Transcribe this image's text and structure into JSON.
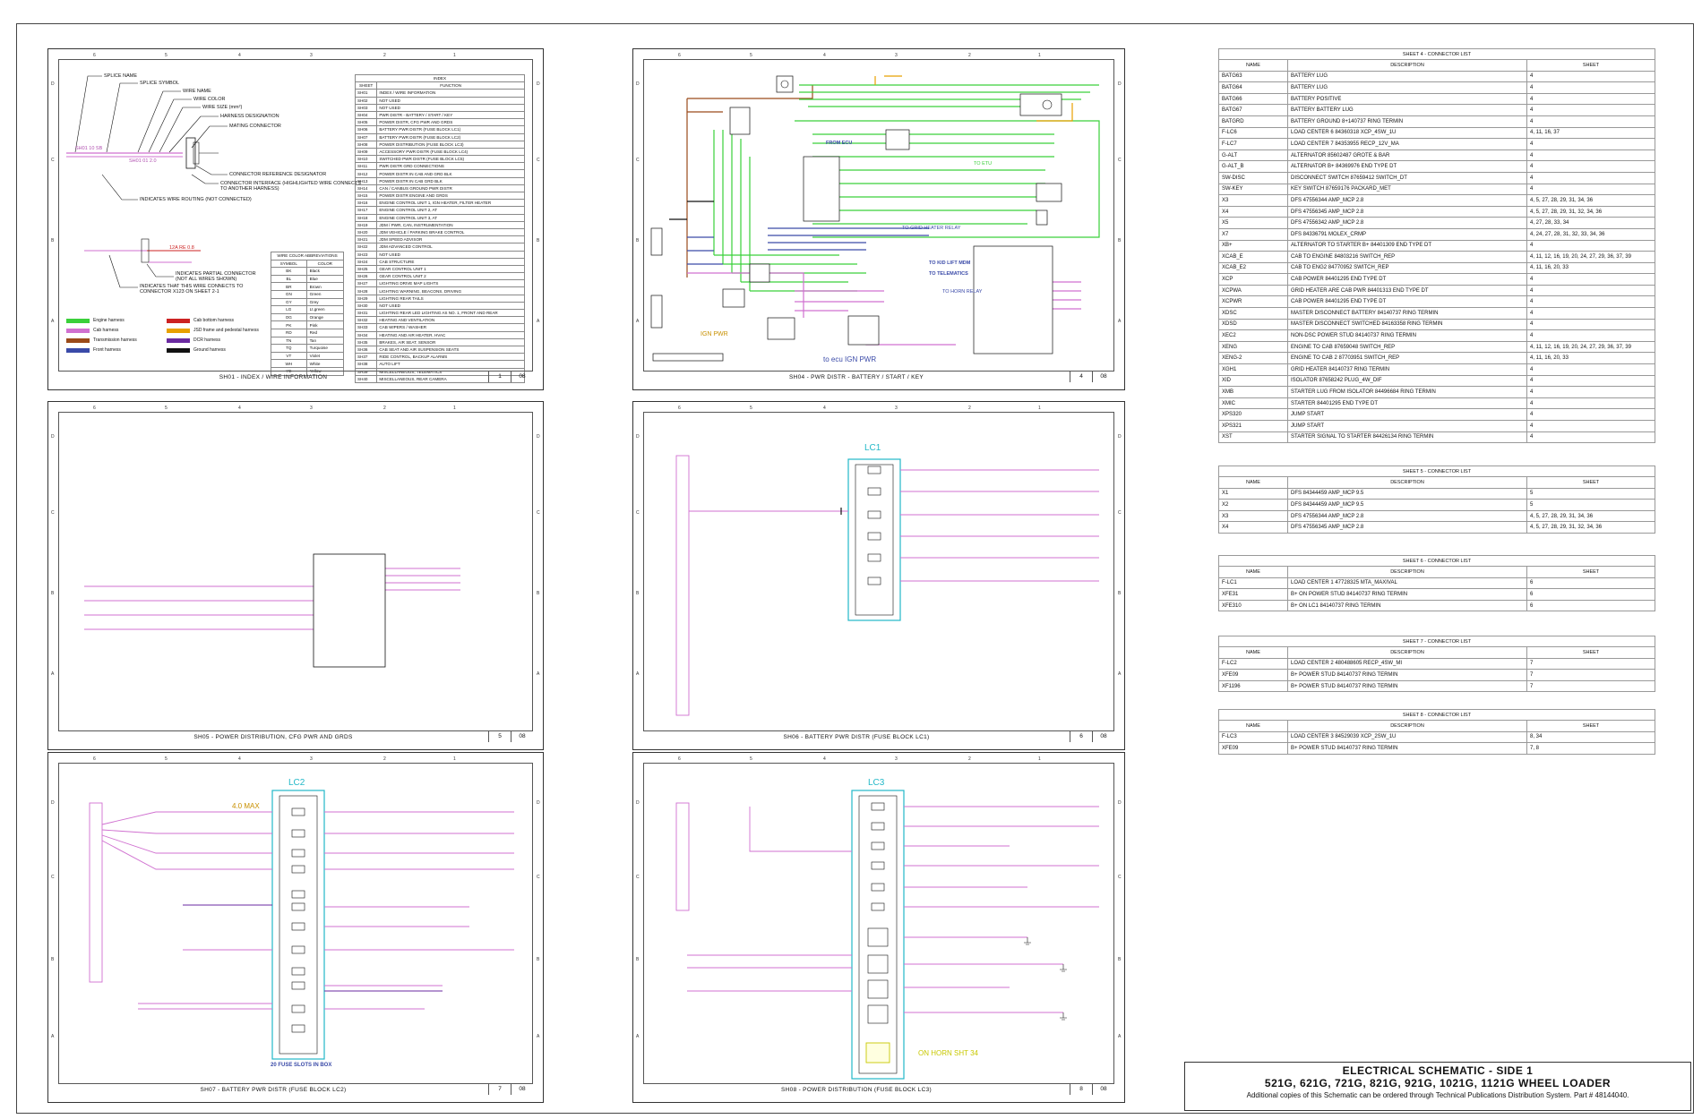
{
  "colors": {
    "engine": "#3ad03a",
    "cab": "#d070d0",
    "transmission": "#9a4a1a",
    "front": "#3a4aa8",
    "cab_bottom": "#cc2222",
    "jsd": "#e8a000",
    "dcr": "#6a2aa0",
    "ground": "#111111",
    "fuse_box": "#22b8c8"
  },
  "sheets": [
    {
      "title": "SH01 - INDEX / WIRE INFORMATION",
      "num": "1",
      "of": "08"
    },
    {
      "title": "SH04 - PWR DISTR - BATTERY / START / KEY",
      "num": "4",
      "of": "08"
    },
    {
      "title": "SH05 - POWER DISTRIBUTION, CFG PWR AND GRDS",
      "num": "5",
      "of": "08"
    },
    {
      "title": "SH06 - BATTERY PWR DISTR (FUSE BLOCK LC1)",
      "num": "6",
      "of": "08"
    },
    {
      "title": "SH07 - BATTERY PWR DISTR (FUSE BLOCK LC2)",
      "num": "7",
      "of": "08"
    },
    {
      "title": "SH08 - POWER DISTRIBUTION (FUSE BLOCK LC3)",
      "num": "8",
      "of": "08"
    }
  ],
  "sheet1": {
    "index_title": "INDEX",
    "index_head": [
      "SHEET",
      "FUNCTION"
    ],
    "index_rows": [
      [
        "SH01",
        "INDEX / WIRE INFORMATION"
      ],
      [
        "SH02",
        "NOT USED"
      ],
      [
        "SH03",
        "NOT USED"
      ],
      [
        "SH04",
        "PWR DISTR - BATTERY / START / KEY"
      ],
      [
        "SH05",
        "POWER DISTR, CFG PWR AND GRDS"
      ],
      [
        "SH06",
        "BATTERY PWR DISTR (FUSE BLOCK LC1)"
      ],
      [
        "SH07",
        "BATTERY PWR DISTR (FUSE BLOCK LC2)"
      ],
      [
        "SH08",
        "POWER DISTRIBUTION (FUSE BLOCK LC3)"
      ],
      [
        "SH09",
        "ACCESSORY PWR DISTR (FUSE BLOCK LC4)"
      ],
      [
        "SH10",
        "SWITCHED PWR DISTR (FUSE BLOCK LC5)"
      ],
      [
        "SH11",
        "PWR DISTR GRD CONNECTIONS"
      ],
      [
        "SH12",
        "POWER DISTR IN CAB AND GRD BLK"
      ],
      [
        "SH13",
        "POWER DISTR IN CAB GRD BLK"
      ],
      [
        "SH14",
        "CAN / CANBUS GROUND PWR DISTR"
      ],
      [
        "SH15",
        "POWER DISTR ENGINE AND GRDS"
      ],
      [
        "SH16",
        "ENGINE CONTROL UNIT 1, IGN HEATER, FILTER HEATER"
      ],
      [
        "SH17",
        "ENGINE CONTROL UNIT 2, AT"
      ],
      [
        "SH18",
        "ENGINE CONTROL UNIT 3, AT"
      ],
      [
        "SH19",
        "JDM / PWR, CAN, INSTRUMENTATION"
      ],
      [
        "SH20",
        "JDM VEHICLE / PARKING BRAKE CONTROL"
      ],
      [
        "SH21",
        "JDM SPEED ADVISOR"
      ],
      [
        "SH22",
        "JDM ADVANCED CONTROL"
      ],
      [
        "SH23",
        "NOT USED"
      ],
      [
        "SH24",
        "CAB STRUCTURE"
      ],
      [
        "SH25",
        "GEAR CONTROL UNIT 1"
      ],
      [
        "SH26",
        "GEAR CONTROL UNIT 2"
      ],
      [
        "SH27",
        "LIGHTING DRIVE MAP LIGHTS"
      ],
      [
        "SH28",
        "LIGHTING WARNING, BEACONS, DRIVING"
      ],
      [
        "SH29",
        "LIGHTING REAR TAILS"
      ],
      [
        "SH30",
        "NOT USED"
      ],
      [
        "SH31",
        "LIGHTING REAR LED LIGHTING AS NO. 1, FRONT AND REAR"
      ],
      [
        "SH32",
        "HEATING AND VENTILATION"
      ],
      [
        "SH33",
        "CAB WIPERS / WASHER"
      ],
      [
        "SH34",
        "HEATING AND AIR HEATER, HVAC"
      ],
      [
        "SH35",
        "BRAKES, AIR SEAT, SENSOR"
      ],
      [
        "SH36",
        "CAB SEAT AND AIR SUSPENSION SEATS"
      ],
      [
        "SH37",
        "RIDE CONTROL, BACKUP ALARMS"
      ],
      [
        "SH38",
        "AUTO LIFT"
      ],
      [
        "SH39",
        "MISCELLANEOUS, TELEMATICS"
      ],
      [
        "SH40",
        "MISCELLANEOUS, REAR CAMERA"
      ]
    ],
    "callouts": [
      "SPLICE NAME",
      "SPLICE SYMBOL",
      "WIRE NAME",
      "WIRE COLOR",
      "WIRE SIZE (mm²)",
      "HARNESS DESIGNATION",
      "MATING CONNECTOR",
      "CONNECTOR REFERENCE DESIGNATOR",
      "CONNECTOR INTERFACE (HIGHLIGHTED WIRE CONNECTS TO ANOTHER HARNESS)",
      "INDICATES WIRE ROUTING (NOT CONNECTED)",
      "INDICATES PARTIAL CONNECTOR (NOT ALL WIRES SHOWN)",
      "INDICATES THAT THIS WIRE CONNECTS TO CONNECTOR X123 ON SHEET 2-1"
    ],
    "sample_wire_a": "SH01 10  SB",
    "sample_wire_b": "SH01 01 2.0",
    "sample_wire_c": "12A  RE 0.8",
    "wire_table_title": "WIRE COLOR ABBREVIATIONS",
    "wire_head": [
      "SYMBOL",
      "COLOR"
    ],
    "wire_rows": [
      [
        "BK",
        "Black"
      ],
      [
        "BL",
        "Blue"
      ],
      [
        "BR",
        "Brown"
      ],
      [
        "GN",
        "Green"
      ],
      [
        "GY",
        "Grey"
      ],
      [
        "LG",
        "Lt.green"
      ],
      [
        "OG",
        "Orange"
      ],
      [
        "PK",
        "Pink"
      ],
      [
        "RD",
        "Red"
      ],
      [
        "TN",
        "Tan"
      ],
      [
        "TQ",
        "Turquoise"
      ],
      [
        "VT",
        "Violet"
      ],
      [
        "WH",
        "White"
      ],
      [
        "YE",
        "Yellow"
      ]
    ],
    "legend": [
      {
        "label": "Engine harness",
        "color": "#3ad03a"
      },
      {
        "label": "Cab bottom harness",
        "color": "#cc2222"
      },
      {
        "label": "Cab harness",
        "color": "#d070d0"
      },
      {
        "label": "JSD frame and pedestal harness",
        "color": "#e8a000"
      },
      {
        "label": "Transmission harness",
        "color": "#9a4a1a"
      },
      {
        "label": "DCR harness",
        "color": "#6a2aa0"
      },
      {
        "label": "Front harness",
        "color": "#3a4aa8"
      },
      {
        "label": "Ground harness",
        "color": "#111111"
      }
    ]
  },
  "sheet4": {
    "labels": {
      "from_ecu": "FROM ECU",
      "to_grid": "TO GRID HEATER RELAY",
      "to_lift": "TO KID LIFT MDM",
      "to_tele": "TO TELEMATICS",
      "to_ecu_ign": "to ecu IGN PWR",
      "ign_pwr": "IGN PWR",
      "to_etu": "TO ETU",
      "to_horn": "TO HORN RELAY"
    }
  },
  "sheet6": {
    "fuse_label": "LC1"
  },
  "sheet7": {
    "fuse_label": "LC2",
    "note": "4.0 MAX",
    "bottom_note": "20 FUSE SLOTS IN BOX"
  },
  "sheet8": {
    "fuse_label": "LC3",
    "horn_note": "ON HORN SHT 34"
  },
  "conn_head": [
    "NAME",
    "DESCRIPTION",
    "SHEET"
  ],
  "conn_lists": [
    {
      "title": "SHEET 4 - CONNECTOR LIST",
      "rows": [
        [
          "BATG63",
          "BATTERY LUG",
          "4"
        ],
        [
          "BATG64",
          "BATTERY LUG",
          "4"
        ],
        [
          "BATG66",
          "BATTERY POSITIVE",
          "4"
        ],
        [
          "BATG67",
          "BATTERY BATTERY LUG",
          "4"
        ],
        [
          "BATGRD",
          "BATTERY GROUND 8+140737 RING TERMIN",
          "4"
        ],
        [
          "F-LC6",
          "LOAD CENTER 6 84360318 XCP_4SW_1U",
          "4, 11, 16, 37"
        ],
        [
          "F-LC7",
          "LOAD CENTER 7 84353955 RECP_12V_MA",
          "4"
        ],
        [
          "G-ALT",
          "ALTERNATOR 85602487 GROTE & BAR",
          "4"
        ],
        [
          "G-ALT_B",
          "ALTERNATOR B+ 84369976 END TYPE DT",
          "4"
        ],
        [
          "SW-DISC",
          "DISCONNECT SWITCH 87659412 SWITCH_DT",
          "4"
        ],
        [
          "SW-KEY",
          "KEY SWITCH 87659176 PACKARD_MET",
          "4"
        ],
        [
          "X3",
          "DFS 47556344 AMP_MCP 2.8",
          "4, 5, 27, 28, 29, 31, 34, 36"
        ],
        [
          "X4",
          "DFS 47556345 AMP_MCP 2.8",
          "4, 5, 27, 28, 29, 31, 32, 34, 36"
        ],
        [
          "X5",
          "DFS 47556342 AMP_MCP 2.8",
          "4, 27, 28, 33, 34"
        ],
        [
          "X7",
          "DFS 84336791 MOLEX_CRMP",
          "4, 24, 27, 28, 31, 32, 33, 34, 36"
        ],
        [
          "XB+",
          "ALTERNATOR TO STARTER B+ 84401309 END TYPE DT",
          "4"
        ],
        [
          "XCAB_E",
          "CAB TO ENGINE 84803216 SWITCH_REP",
          "4, 11, 12, 16, 19, 20, 24, 27, 29, 36, 37, 39"
        ],
        [
          "XCAB_E2",
          "CAB TO ENG2 84770952 SWITCH_REP",
          "4, 11, 16, 20, 33"
        ],
        [
          "XCP",
          "CAB POWER 84401295 END TYPE DT",
          "4"
        ],
        [
          "XCPWA",
          "GRID HEATER ARE CAB PWR 84401313 END TYPE DT",
          "4"
        ],
        [
          "XCPWR",
          "CAB POWER 84401295 END TYPE DT",
          "4"
        ],
        [
          "XDSC",
          "MASTER DISCONNECT BATTERY 84140737 RING TERMIN",
          "4"
        ],
        [
          "XDSD",
          "MASTER DISCONNECT SWITCHED 84163358 RING TERMIN",
          "4"
        ],
        [
          "XEC2",
          "NON-DSC POWER STUD 84140737 RING TERMIN",
          "4"
        ],
        [
          "XENG",
          "ENGINE TO CAB 87659048 SWITCH_REP",
          "4, 11, 12, 16, 19, 20, 24, 27, 29, 36, 37, 39"
        ],
        [
          "XENG-2",
          "ENGINE TO CAB 2 87703951 SWITCH_REP",
          "4, 11, 16, 20, 33"
        ],
        [
          "XGH1",
          "GRID HEATER 84140737 RING TERMIN",
          "4"
        ],
        [
          "XID",
          "ISOLATOR 87658242 PLUG_4W_DIF",
          "4"
        ],
        [
          "XMB",
          "STARTER LUG FROM ISOLATOR 84496684 RING TERMIN",
          "4"
        ],
        [
          "XMIC",
          "STARTER 84401295 END TYPE DT",
          "4"
        ],
        [
          "XPS320",
          "JUMP START",
          "4"
        ],
        [
          "XPS321",
          "JUMP START",
          "4"
        ],
        [
          "XST",
          "STARTER SIGNAL TO STARTER 84426134 RING TERMIN",
          "4"
        ]
      ]
    },
    {
      "title": "SHEET 5 - CONNECTOR LIST",
      "rows": [
        [
          "X1",
          "DFS 84344459 AMP_MCP 9.5",
          "5"
        ],
        [
          "X2",
          "DFS 84344459 AMP_MCP 9.5",
          "5"
        ],
        [
          "X3",
          "DFS 47556344 AMP_MCP 2.8",
          "4, 5, 27, 28, 29, 31, 34, 36"
        ],
        [
          "X4",
          "DFS 47556345 AMP_MCP 2.8",
          "4, 5, 27, 28, 29, 31, 32, 34, 36"
        ]
      ]
    },
    {
      "title": "SHEET 6 - CONNECTOR LIST",
      "rows": [
        [
          "F-LC1",
          "LOAD CENTER 1 47728325 MTA_MAXIVAL",
          "6"
        ],
        [
          "XFE31",
          "B+ ON POWER STUD 84140737 RING TERMIN",
          "6"
        ],
        [
          "XFE310",
          "B+ ON LC1 84140737 RING TERMIN",
          "6"
        ]
      ]
    },
    {
      "title": "SHEET 7 - CONNECTOR LIST",
      "rows": [
        [
          "F-LC2",
          "LOAD CENTER 2 480488605 RECP_4SW_MI",
          "7"
        ],
        [
          "XFE09",
          "B+ POWER STUD 84140737 RING TERMIN",
          "7"
        ],
        [
          "XF1196",
          "B+ POWER STUD 84140737 RING TERMIN",
          "7"
        ]
      ]
    },
    {
      "title": "SHEET 8 - CONNECTOR LIST",
      "rows": [
        [
          "F-LC3",
          "LOAD CENTER 3 84529039 XCP_2SW_1U",
          "8, 34"
        ],
        [
          "XFE09",
          "B+ POWER STUD 84140737 RING TERMIN",
          "7, 8"
        ]
      ]
    }
  ],
  "title_block": {
    "line1": "ELECTRICAL SCHEMATIC - SIDE 1",
    "line2": "521G, 621G, 721G, 821G, 921G, 1021G, 1121G  WHEEL LOADER",
    "line3": "Additional copies of this Schematic can be ordered through Technical Publications Distribution System. Part # 48144040."
  }
}
